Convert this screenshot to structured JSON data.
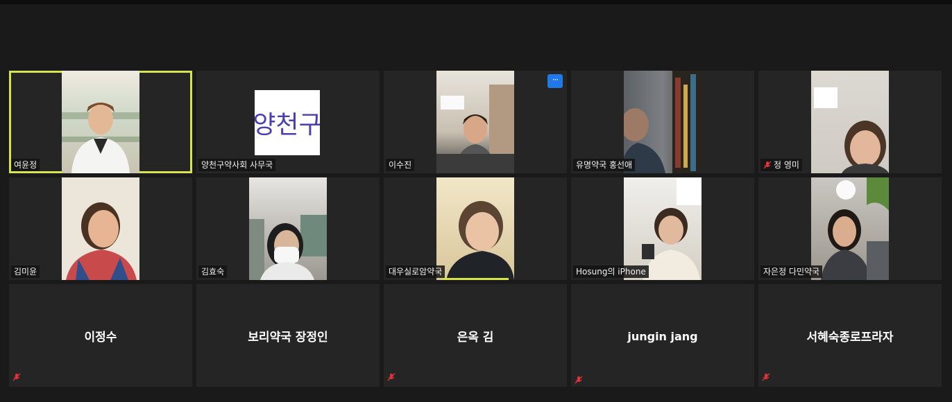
{
  "meeting": {
    "participants": [
      {
        "name": "여윤정",
        "type": "video",
        "active": true,
        "muted": false,
        "bg": "#d9d5c7"
      },
      {
        "name": "양천구약사회 사무국",
        "type": "logo",
        "logo_text": "양천구",
        "muted": false
      },
      {
        "name": "이수진",
        "type": "video",
        "muted": false,
        "more": "···",
        "bg": "#cfc6b8"
      },
      {
        "name": "유명약국 홍선애",
        "type": "video",
        "muted": false,
        "bg": "#3a3a3a"
      },
      {
        "name": "정 영미",
        "type": "video",
        "muted": true,
        "bg": "#cfc9c0"
      },
      {
        "name": "김미윤",
        "type": "video",
        "muted": false,
        "bg": "#e8e2d6"
      },
      {
        "name": "김효숙",
        "type": "video",
        "muted": false,
        "bg": "#c9c6bd"
      },
      {
        "name": "대우실로암약국",
        "type": "video",
        "muted": false,
        "speaking": true,
        "bg": "#d7c9a8"
      },
      {
        "name": "Hosung의 iPhone",
        "type": "video",
        "muted": false,
        "bg": "#d8d4cc"
      },
      {
        "name": "자은정 다민약국",
        "type": "video",
        "muted": false,
        "bg": "#b9b4a9"
      },
      {
        "name": "이정수",
        "type": "name-only",
        "muted": true
      },
      {
        "name": "보리약국 장정인",
        "type": "name-only",
        "muted": false
      },
      {
        "name": "은옥 김",
        "type": "name-only",
        "muted": true
      },
      {
        "name": "jungin jang",
        "type": "name-only",
        "muted": true
      },
      {
        "name": "서혜숙종로프라자",
        "type": "name-only",
        "muted": true
      }
    ],
    "colors": {
      "active_border": "#d6e64a",
      "mute_icon": "#e0323a",
      "accent": "#1f7ae8"
    }
  }
}
